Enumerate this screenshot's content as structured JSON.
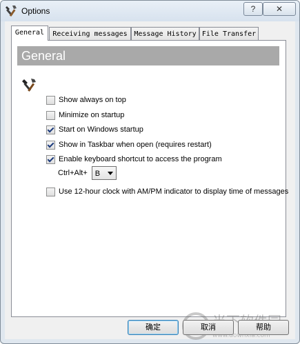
{
  "window": {
    "title": "Options",
    "help_label": "?",
    "close_label": "✕"
  },
  "tabs": [
    {
      "label": "General"
    },
    {
      "label": "Receiving messages"
    },
    {
      "label": "Message History"
    },
    {
      "label": "File Transfer"
    }
  ],
  "panel": {
    "header": "General",
    "options": [
      {
        "label": "Show always on top",
        "checked": false
      },
      {
        "label": "Minimize on startup",
        "checked": false
      },
      {
        "label": "Start on Windows startup",
        "checked": true
      },
      {
        "label": "Show in Taskbar when open (requires restart)",
        "checked": true
      },
      {
        "label": "Enable keyboard shortcut to access the program",
        "checked": true
      }
    ],
    "shortcut_label": "Ctrl+Alt+",
    "shortcut_value": "B",
    "clock_option": {
      "label": "Use 12-hour clock with AM/PM indicator to display time of messages",
      "checked": false
    }
  },
  "buttons": {
    "ok": "确定",
    "cancel": "取消",
    "help": "帮助"
  },
  "watermark": {
    "text": "当下软件园",
    "url": "www.downxia.com"
  },
  "colors": {
    "header_bg": "#a9a9a9",
    "check": "#1b3a7c"
  }
}
